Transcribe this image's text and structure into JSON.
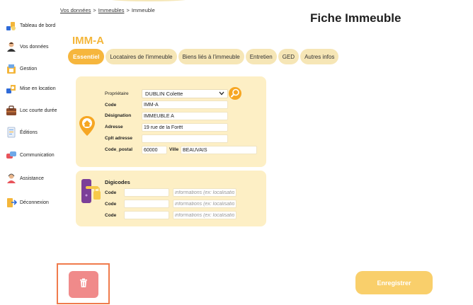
{
  "breadcrumb": {
    "item1": "Vos données",
    "item2": "Immeubles",
    "item3": "Immeuble",
    "sep": ">"
  },
  "page_title": "Fiche Immeuble",
  "record_title": "IMM-A",
  "sidebar": {
    "items": [
      {
        "label": "Tableau de bord",
        "icon": "dashboard-icon"
      },
      {
        "label": "Vos données",
        "icon": "user-data-icon"
      },
      {
        "label": "Gestion",
        "icon": "management-icon"
      },
      {
        "label": "Mise en location",
        "icon": "rental-icon"
      },
      {
        "label": "Loc courte durée",
        "icon": "suitcase-icon"
      },
      {
        "label": "Éditions",
        "icon": "document-icon"
      },
      {
        "label": "Communication",
        "icon": "chat-icon"
      },
      {
        "label": "Assistance",
        "icon": "support-icon"
      },
      {
        "label": "Déconnexion",
        "icon": "logout-icon"
      }
    ]
  },
  "tabs": [
    {
      "label": "Essentiel",
      "active": true
    },
    {
      "label": "Locataires de l'immeuble",
      "active": false
    },
    {
      "label": "Biens liés à l'immeuble",
      "active": false
    },
    {
      "label": "Entretien",
      "active": false
    },
    {
      "label": "GED",
      "active": false
    },
    {
      "label": "Autres infos",
      "active": false
    }
  ],
  "form": {
    "proprietaire_label": "Propriétaire",
    "proprietaire_value": "DUBLIN Colette",
    "code_label": "Code",
    "code_value": "IMM-A",
    "designation_label": "Désignation",
    "designation_value": "IMMEUBLE A",
    "adresse_label": "Adresse",
    "adresse_value": "19 rue de la Forêt",
    "cplt_label": "Cplt adresse",
    "cplt_value": "",
    "code_postal_label": "Code_postal",
    "code_postal_value": "60000",
    "ville_label": "Ville",
    "ville_value": "BEAUVAIS"
  },
  "digicodes": {
    "title": "Digicodes",
    "code_label": "Code",
    "info_placeholder": "informations (ex: localisation)",
    "rows": [
      {
        "code": "",
        "info": ""
      },
      {
        "code": "",
        "info": ""
      },
      {
        "code": "",
        "info": ""
      }
    ]
  },
  "save_label": "Enregistrer",
  "colors": {
    "accent": "#f6b63d",
    "card": "#fdefc5",
    "tab": "#f6e6b6",
    "delete": "#f08a8a",
    "save": "#f9cf6b"
  }
}
